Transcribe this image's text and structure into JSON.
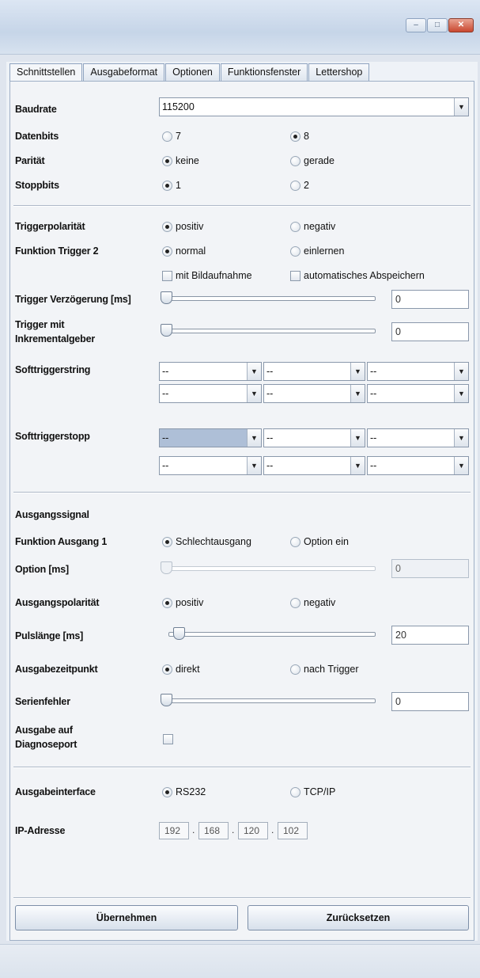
{
  "window": {
    "title": "",
    "buttons": {
      "minimize": "–",
      "maximize": "□",
      "close": "✕"
    }
  },
  "tabs": [
    "Schnittstellen",
    "Ausgabeformat",
    "Optionen",
    "Funktionsfenster",
    "Lettershop"
  ],
  "active_tab": "Schnittstellen",
  "serial": {
    "baudrate": {
      "label": "Baudrate",
      "value": "115200"
    },
    "datenbits": {
      "label": "Datenbits",
      "options": [
        "7",
        "8"
      ],
      "selected": "8"
    },
    "paritaet": {
      "label": "Parität",
      "options": [
        "keine",
        "gerade"
      ],
      "selected": "keine"
    },
    "stoppbits": {
      "label": "Stoppbits",
      "options": [
        "1",
        "2"
      ],
      "selected": "1"
    }
  },
  "trigger": {
    "polaritaet": {
      "label": "Triggerpolarität",
      "options": [
        "positiv",
        "negativ"
      ],
      "selected": "positiv"
    },
    "funktion2": {
      "label": "Funktion Trigger 2",
      "options": [
        "normal",
        "einlernen"
      ],
      "selected": "normal"
    },
    "checks": {
      "bildaufnahme": "mit Bildaufnahme",
      "abspeichern": "automatisches Abspeichern"
    },
    "verzoegerung": {
      "label": "Trigger Verzögerung [ms]",
      "value": "0",
      "level": 0
    },
    "inkrement": {
      "label_1": "Trigger mit",
      "label_2": "Inkrementalgeber",
      "value": "0",
      "level": 0
    },
    "softtriggerstring": {
      "label": "Softtriggerstring",
      "values": [
        "--",
        "--",
        "--",
        "--",
        "--",
        "--"
      ]
    },
    "softtriggerstopp": {
      "label": "Softtriggerstopp",
      "values": [
        "--",
        "--",
        "--",
        "--",
        "--",
        "--"
      ]
    }
  },
  "output": {
    "ausgangssignal": "Ausgangssignal",
    "funktion1": {
      "label": "Funktion Ausgang 1",
      "options": [
        "Schlechtausgang",
        "Option ein"
      ],
      "selected": "Schlechtausgang"
    },
    "option_ms": {
      "label": "Option [ms]",
      "value": "0",
      "level": 0
    },
    "polaritaet": {
      "label": "Ausgangspolarität",
      "options": [
        "positiv",
        "negativ"
      ],
      "selected": "positiv"
    },
    "pulslaenge": {
      "label": "Pulslänge [ms]",
      "value": "20",
      "level": 0.03
    },
    "zeitpunkt": {
      "label": "Ausgabezeitpunkt",
      "options": [
        "direkt",
        "nach Trigger"
      ],
      "selected": "direkt"
    },
    "serienfehler": {
      "label": "Serienfehler",
      "value": "0",
      "level": 0
    },
    "diagnose": {
      "label_1": "Ausgabe auf",
      "label_2": "Diagnoseport"
    }
  },
  "interface": {
    "label": "Ausgabeinterface",
    "options": [
      "RS232",
      "TCP/IP"
    ],
    "selected": "RS232",
    "ip": {
      "label": "IP-Adresse",
      "octets": [
        "192",
        "168",
        "120",
        "102"
      ]
    }
  },
  "actions": {
    "apply": "Übernehmen",
    "reset": "Zurücksetzen"
  },
  "colors": {
    "accent": "#aebfd7",
    "background": "#f2f4f7"
  }
}
